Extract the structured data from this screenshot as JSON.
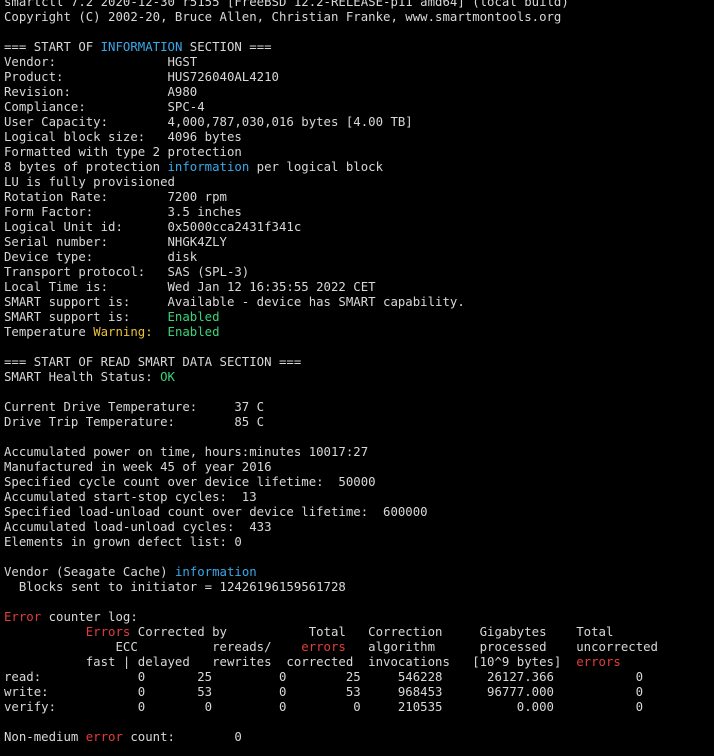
{
  "colors": {
    "default": "#d8d8d8",
    "blue": "#3aa8e8",
    "green": "#3bd37a",
    "red": "#e23d3d",
    "yellow": "#e8c23a",
    "background": "#000000"
  },
  "lines": [
    [
      {
        "t": "smartctl 7.2 2020-12-30 r5155 [FreeBSD 12.2-RELEASE-p11 amd64] (local build)"
      }
    ],
    [
      {
        "t": "Copyright (C) 2002-20, Bruce Allen, Christian Franke, www.smartmontools.org"
      }
    ],
    [
      {
        "t": ""
      }
    ],
    [
      {
        "t": "=== START OF "
      },
      {
        "t": "INFORMATION",
        "c": "blue"
      },
      {
        "t": " SECTION ==="
      }
    ],
    [
      {
        "t": "Vendor:               HGST"
      }
    ],
    [
      {
        "t": "Product:              HUS726040AL4210"
      }
    ],
    [
      {
        "t": "Revision:             A980"
      }
    ],
    [
      {
        "t": "Compliance:           SPC-4"
      }
    ],
    [
      {
        "t": "User Capacity:        4,000,787,030,016 bytes [4.00 TB]"
      }
    ],
    [
      {
        "t": "Logical block size:   4096 bytes"
      }
    ],
    [
      {
        "t": "Formatted with type 2 protection"
      }
    ],
    [
      {
        "t": "8 bytes of protection "
      },
      {
        "t": "information",
        "c": "blue"
      },
      {
        "t": " per logical block"
      }
    ],
    [
      {
        "t": "LU is fully provisioned"
      }
    ],
    [
      {
        "t": "Rotation Rate:        7200 rpm"
      }
    ],
    [
      {
        "t": "Form Factor:          3.5 inches"
      }
    ],
    [
      {
        "t": "Logical Unit id:      0x5000cca2431f341c"
      }
    ],
    [
      {
        "t": "Serial number:        NHGK4ZLY"
      }
    ],
    [
      {
        "t": "Device type:          disk"
      }
    ],
    [
      {
        "t": "Transport protocol:   SAS (SPL-3)"
      }
    ],
    [
      {
        "t": "Local Time is:        Wed Jan 12 16:35:55 2022 CET"
      }
    ],
    [
      {
        "t": "SMART support is:     Available - device has SMART capability."
      }
    ],
    [
      {
        "t": "SMART support is:     "
      },
      {
        "t": "Enabled",
        "c": "green"
      }
    ],
    [
      {
        "t": "Temperature "
      },
      {
        "t": "Warning:",
        "c": "yellow"
      },
      {
        "t": "  "
      },
      {
        "t": "Enabled",
        "c": "green"
      }
    ],
    [
      {
        "t": ""
      }
    ],
    [
      {
        "t": "=== START OF READ SMART DATA SECTION ==="
      }
    ],
    [
      {
        "t": "SMART Health Status: "
      },
      {
        "t": "OK",
        "c": "green"
      }
    ],
    [
      {
        "t": ""
      }
    ],
    [
      {
        "t": "Current Drive Temperature:     37 C"
      }
    ],
    [
      {
        "t": "Drive Trip Temperature:        85 C"
      }
    ],
    [
      {
        "t": ""
      }
    ],
    [
      {
        "t": "Accumulated power on time, hours:minutes 10017:27"
      }
    ],
    [
      {
        "t": "Manufactured in week 45 of year 2016"
      }
    ],
    [
      {
        "t": "Specified cycle count over device lifetime:  50000"
      }
    ],
    [
      {
        "t": "Accumulated start-stop cycles:  13"
      }
    ],
    [
      {
        "t": "Specified load-unload count over device lifetime:  600000"
      }
    ],
    [
      {
        "t": "Accumulated load-unload cycles:  433"
      }
    ],
    [
      {
        "t": "Elements in grown defect list: 0"
      }
    ],
    [
      {
        "t": ""
      }
    ],
    [
      {
        "t": "Vendor (Seagate Cache) "
      },
      {
        "t": "information",
        "c": "blue"
      }
    ],
    [
      {
        "t": "  Blocks sent to initiator = 12426196159561728"
      }
    ],
    [
      {
        "t": ""
      }
    ],
    [
      {
        "t": "Error",
        "c": "red"
      },
      {
        "t": " counter log:"
      }
    ],
    [
      {
        "t": "           "
      },
      {
        "t": "Errors",
        "c": "red"
      },
      {
        "t": " Corrected by           Total   Correction     Gigabytes    Total"
      }
    ],
    [
      {
        "t": "               ECC          rereads/    "
      },
      {
        "t": "errors",
        "c": "red"
      },
      {
        "t": "   algorithm      processed    uncorrected"
      }
    ],
    [
      {
        "t": "           fast | delayed   rewrites  corrected  invocations   [10^9 bytes]  "
      },
      {
        "t": "errors",
        "c": "red"
      }
    ],
    [
      {
        "t": "read:             0       25         0        25     546228      26127.366           0"
      }
    ],
    [
      {
        "t": "write:            0       53         0        53     968453      96777.000           0"
      }
    ],
    [
      {
        "t": "verify:           0        0         0         0     210535          0.000           0"
      }
    ],
    [
      {
        "t": ""
      }
    ],
    [
      {
        "t": "Non-medium "
      },
      {
        "t": "error",
        "c": "red"
      },
      {
        "t": " count:        0"
      }
    ]
  ]
}
